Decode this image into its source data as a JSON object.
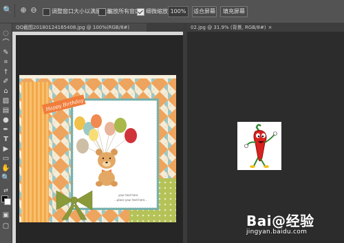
{
  "options": {
    "resize_windows_label": "调整窗口大小以满屏显示",
    "zoom_all_label": "缩放所有窗口",
    "scrubby_zoom_label": "细微缩放",
    "zoom_value": "100%",
    "fit_screen_label": "适合屏幕",
    "fill_screen_label": "填充屏幕"
  },
  "tabs": {
    "left": "QQ截图20180124165408.jpg @ 100%(RGB/8#)",
    "right": "02.jpg @ 31.9% (背景, RGB/8#)"
  },
  "card": {
    "banner": "Happy Birthday",
    "line1": "your text here",
    "line2": "...place your text here..."
  },
  "watermark": {
    "main": "Bai@经验",
    "sub": "jingyan.baidu.com"
  },
  "colors": {
    "options_bar": "#535353",
    "workspace": "#282828",
    "card_orange": "#f0a050",
    "card_green": "#a9b84a"
  }
}
